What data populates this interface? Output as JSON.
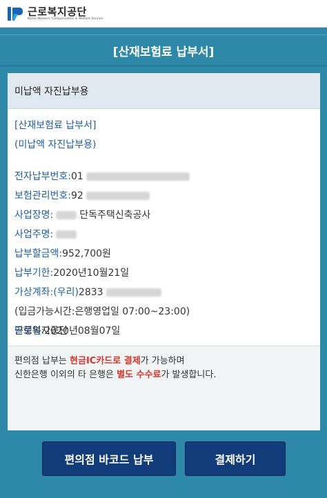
{
  "header": {
    "logo_name": "근로복지공단",
    "logo_subtitle": "Korea Workers' Compensation & Welfare Service"
  },
  "title": "[산재보험료 납부서]",
  "card": {
    "heading": "미납액 자진납부용",
    "title_line1": "[산재보험료 납부서]",
    "title_line2": "(미납액 자진납부용)",
    "fields": {
      "payment_no_label": "전자납부번호:",
      "payment_no_value": "01",
      "insurance_no_label": "보험관리번호:",
      "insurance_no_value": "92",
      "business_name_label": "사업장명:",
      "business_name_value": "단독주택신축공사",
      "owner_label": "사업주명:",
      "amount_label": "납부할금액:",
      "amount_value": "952,700원",
      "due_label": "납부기한:",
      "due_value": "2020년10월21일",
      "account_label": "가상계좌:(우리)",
      "account_value": "2833",
      "hours_text": "(입금가능시간:은행영업일 07:00~23:00)",
      "issue_label": "발행일:",
      "issue_value": "2020년08월07일"
    },
    "org_name": "근로복지공단",
    "notice": {
      "l1_a": "편의점 납부는 ",
      "l1_b": "현금IC카드로 결제",
      "l1_c": "가 가능하며",
      "l2_a": "신한은행 이외의 타 은행은 ",
      "l2_b": "별도 수수료",
      "l2_c": "가 발생합니다."
    }
  },
  "buttons": {
    "barcode": "편의점 바코드 납부",
    "pay": "결제하기"
  },
  "colors": {
    "primary": "#2e89a8",
    "button": "#123c79",
    "label_blue": "#1f5fa8",
    "highlight_red": "#d9342b"
  },
  "icons": {
    "logo": "kcomwel-logo-icon"
  }
}
